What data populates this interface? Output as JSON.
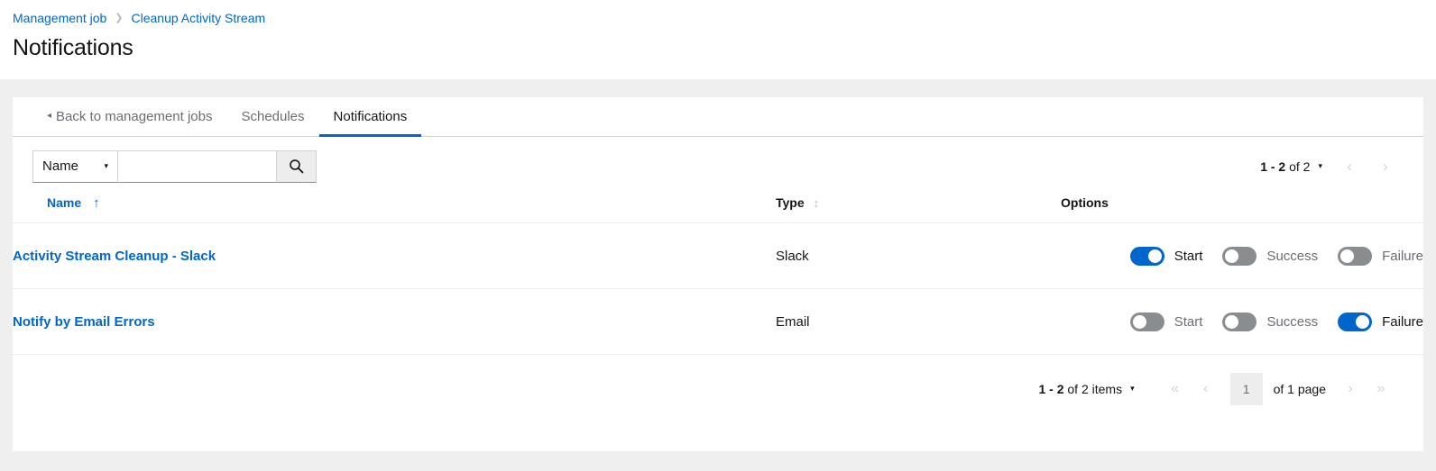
{
  "breadcrumb": {
    "items": [
      {
        "label": "Management job"
      },
      {
        "label": "Cleanup Activity Stream"
      }
    ],
    "separator": "❯"
  },
  "page_title": "Notifications",
  "tabs": [
    {
      "label": "Back to management jobs",
      "active": false,
      "caret": "◂"
    },
    {
      "label": "Schedules",
      "active": false
    },
    {
      "label": "Notifications",
      "active": true
    }
  ],
  "toolbar": {
    "filter_select_value": "Name",
    "filter_select_caret": "▾",
    "search_value": "",
    "search_placeholder": "",
    "search_button_icon": "search-icon"
  },
  "top_pagination": {
    "summary_range": "1 - 2",
    "summary_of": "of 2",
    "caret": "▾",
    "prev_icon": "‹",
    "next_icon": "›"
  },
  "table": {
    "columns": [
      {
        "key": "name",
        "label": "Name",
        "sort": "asc",
        "sort_icon": "↑"
      },
      {
        "key": "type",
        "label": "Type",
        "sort": "none",
        "sort_icon": "↕"
      },
      {
        "key": "options",
        "label": "Options",
        "sort": null
      }
    ],
    "rows": [
      {
        "name": "Activity Stream Cleanup - Slack",
        "type": "Slack",
        "options": [
          {
            "label": "Start",
            "on": true
          },
          {
            "label": "Success",
            "on": false
          },
          {
            "label": "Failure",
            "on": false
          }
        ]
      },
      {
        "name": "Notify by Email Errors",
        "type": "Email",
        "options": [
          {
            "label": "Start",
            "on": false
          },
          {
            "label": "Success",
            "on": false
          },
          {
            "label": "Failure",
            "on": true
          }
        ]
      }
    ]
  },
  "bottom_pagination": {
    "summary_range": "1 - 2",
    "summary_of": "of 2 items",
    "caret": "▾",
    "first_icon": "«",
    "prev_icon": "‹",
    "page_value": "1",
    "of_pages": "of 1 page",
    "next_icon": "›",
    "last_icon": "»"
  },
  "colors": {
    "accent_blue": "#0066cc",
    "link_blue": "#06c",
    "toggle_off_grey": "#8a8d90",
    "page_bg": "#efefef",
    "card_bg": "#ffffff",
    "text_dark": "#151515",
    "text_muted": "#6a6e73",
    "border": "#d2d2d2"
  }
}
